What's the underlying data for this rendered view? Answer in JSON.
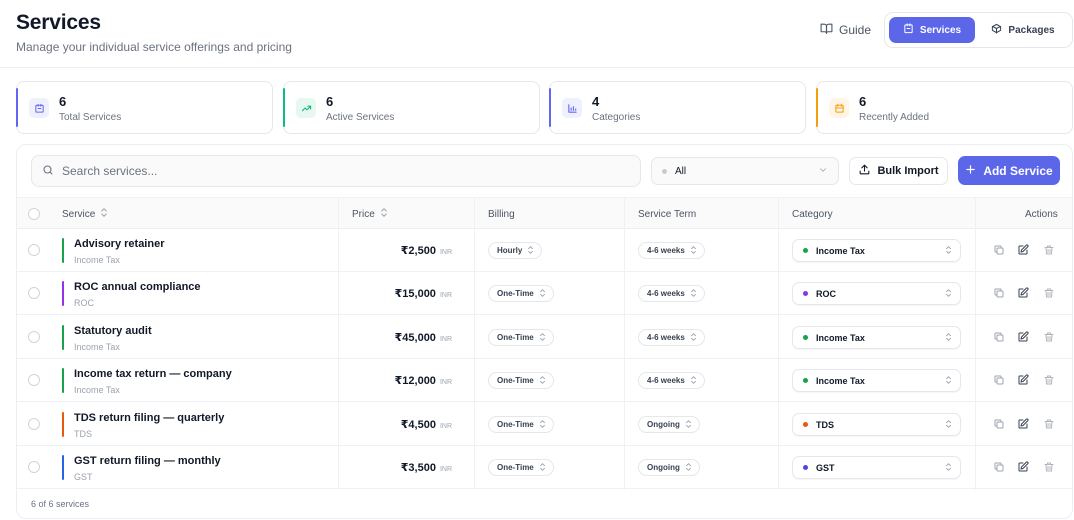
{
  "header": {
    "title": "Services",
    "subtitle": "Manage your individual service offerings and pricing",
    "guide_label": "Guide",
    "tabs": [
      {
        "label": "Services",
        "active": true
      },
      {
        "label": "Packages",
        "active": false
      }
    ]
  },
  "stats": [
    {
      "value": "6",
      "label": "Total Services",
      "color": "#6366f1",
      "icon": "briefcase-icon"
    },
    {
      "value": "6",
      "label": "Active Services",
      "color": "#10b981",
      "icon": "trending-up-icon"
    },
    {
      "value": "4",
      "label": "Categories",
      "color": "#6366f1",
      "icon": "bar-chart-icon"
    },
    {
      "value": "6",
      "label": "Recently Added",
      "color": "#f59e0b",
      "icon": "calendar-icon"
    }
  ],
  "toolbar": {
    "search_placeholder": "Search services...",
    "filter_value": "All",
    "bulk_import_label": "Bulk Import",
    "add_service_label": "Add Service"
  },
  "table": {
    "columns": {
      "service": "Service",
      "price": "Price",
      "billing": "Billing",
      "term": "Service Term",
      "category": "Category",
      "actions": "Actions"
    },
    "rows": [
      {
        "name": "Advisory retainer",
        "sub": "Income Tax",
        "accent": "#16a34a",
        "price": "₹2,500",
        "currency": "INR",
        "billing": "Hourly",
        "term": "4-6 weeks",
        "category": "Income Tax",
        "cat_color": "#16a34a"
      },
      {
        "name": "ROC annual compliance",
        "sub": "ROC",
        "accent": "#9333ea",
        "price": "₹15,000",
        "currency": "INR",
        "billing": "One-Time",
        "term": "4-6 weeks",
        "category": "ROC",
        "cat_color": "#7c3aed"
      },
      {
        "name": "Statutory audit",
        "sub": "Income Tax",
        "accent": "#16a34a",
        "price": "₹45,000",
        "currency": "INR",
        "billing": "One-Time",
        "term": "4-6 weeks",
        "category": "Income Tax",
        "cat_color": "#16a34a"
      },
      {
        "name": "Income tax return — company",
        "sub": "Income Tax",
        "accent": "#16a34a",
        "price": "₹12,000",
        "currency": "INR",
        "billing": "One-Time",
        "term": "4-6 weeks",
        "category": "Income Tax",
        "cat_color": "#16a34a"
      },
      {
        "name": "TDS return filing — quarterly",
        "sub": "TDS",
        "accent": "#ea580c",
        "price": "₹4,500",
        "currency": "INR",
        "billing": "One-Time",
        "term": "Ongoing",
        "category": "TDS",
        "cat_color": "#ea580c"
      },
      {
        "name": "GST return filing — monthly",
        "sub": "GST",
        "accent": "#2563eb",
        "price": "₹3,500",
        "currency": "INR",
        "billing": "One-Time",
        "term": "Ongoing",
        "category": "GST",
        "cat_color": "#4f46e5"
      }
    ]
  },
  "footer": {
    "count_text": "6 of 6 services"
  }
}
